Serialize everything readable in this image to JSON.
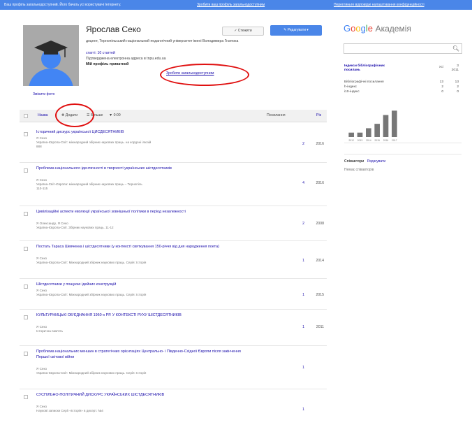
{
  "top_bar": {
    "notice": "Ваш профіль загальнодоступний. Його бачать усі користувачі Інтернету.",
    "link_1": "Зробити ваш профіль загальнодоступним",
    "link_2": "Перегляньте відповідні налаштування конфіденційності"
  },
  "profile": {
    "name": "Ярослав Секо",
    "follow_label": "✓ Стежити",
    "edit_label": "✎ Редагувати ▾",
    "affiliation": "доцент, Тернопільський національний педагогічний університет імені Володимира Гнатюка",
    "profile_link": "статтi: 10 статтей",
    "verified_email": "Підтверджена електронна адреса в tnpu.edu.ua",
    "public_status": "Мій профіль приватний",
    "make_public": "Зробити загальнодоступним",
    "change_photo": "Змінити фото"
  },
  "toolbar": {
    "title_label": "Назва",
    "add_label": "✚ Додати",
    "more_label": "☰ Більше",
    "sort_label": "▼ 0:00",
    "cited_label": "Посилання",
    "year_label": "Рік"
  },
  "articles": [
    {
      "title": "Історичний дискурс української ЦИСДЕСЯТНИКІВ",
      "authors": "Я Секо",
      "source": "Україна-Європа-Світ: міжнародний збірник наукових праць. на кордоні ілюзій",
      "source2": "888",
      "cites": "2",
      "year": "2016"
    },
    {
      "title": "Проблема національного ідентичності в творчості українських шістдесятників",
      "authors": "Я Секо",
      "source": "Україна-Світ-Європа: міжнародний збірник наукових праць – Тернопіль",
      "source2": "110-115",
      "cites": "4",
      "year": "2016"
    },
    {
      "title": "Цивілізаційні аспекти еволюції української зовнішньої політики в період незалежності",
      "authors": "Я Олександр, Я Секо",
      "source": "Україна-Європа-Світ. Збірник наукових праць. 11-12",
      "source2": "",
      "cites": "2",
      "year": "2008"
    },
    {
      "title": "Постать Тараса Шевченка і шістдесятники (у контексті святкування 150-річчя від дня народження поета)",
      "authors": "Я Секо",
      "source": "Україна-Європа-Світ: Міжнародний збірник наукових праць. Серія: Історія",
      "source2": "",
      "cites": "1",
      "year": "2014"
    },
    {
      "title": "Шістдесятники у пошуках ідейних конструкцій",
      "authors": "Я Секо",
      "source": "Україна-Європа-Світ: Міжнародний збірник наукових праць. Серія: Історія",
      "source2": "",
      "cites": "1",
      "year": "2015"
    },
    {
      "title": "КУЛЬТУРНИЦЬКІ ОБ'ЄДНАННЯ 1960-х РР. У КОНТЕКСТІ РУХУ ШІСТДЕСЯТНИКІВ",
      "authors": "Я Секо",
      "source": "Історична пам'ять",
      "source2": "",
      "cites": "1",
      "year": "2011"
    },
    {
      "title": "Проблема національних меншин в стратегічних орієнтаціях Центрально- і Південно-Східної Європи після закінчення Першої світової війни",
      "authors": "Я Секо",
      "source": "Україна-Європа-Світ: Міжнародний збірник наукових праць. Серія: Історія",
      "source2": "",
      "cites": "1",
      "year": ""
    },
    {
      "title": "СУСПІЛЬНО-ПОЛІТИЧНИЙ ДИСКУРС УКРАЇНСЬКИХ ШІСТДЕСЯТНИКІВ",
      "authors": "Я Секо",
      "source": "Наукові записки Серії «Історія» в дисерт. №4",
      "source2": "",
      "cites": "1",
      "year": ""
    }
  ],
  "sidebar": {
    "logo_letters": [
      "G",
      "o",
      "o",
      "g",
      "l",
      "e"
    ],
    "logo_rest": "Академія",
    "search_placeholder": "",
    "metrics_header": "Індекси бібліографічних посилань",
    "metrics_all": "Усі",
    "metrics_since": "З 2011",
    "metrics": [
      {
        "label": "Бібліографічні посилання",
        "all": "13",
        "since": "13"
      },
      {
        "label": "h-індекс",
        "all": "2",
        "since": "2"
      },
      {
        "label": "i10-індекс",
        "all": "0",
        "since": "0"
      }
    ],
    "coauthors_label": "Співавтори",
    "coauthors_edit": "Редагувати",
    "no_coauthors": "Немає співавторів"
  },
  "chart_data": {
    "type": "bar",
    "categories": [
      "2012",
      "2013",
      "2014",
      "2015",
      "2016",
      "2017"
    ],
    "values": [
      1,
      1,
      2,
      3,
      5,
      6
    ],
    "title": "",
    "xlabel": "",
    "ylabel": "",
    "ylim": [
      0,
      7
    ],
    "color": "#777777"
  },
  "colors": {
    "accent": "#4a86e8",
    "link": "#1a0dab",
    "highlight": "#e01010"
  }
}
